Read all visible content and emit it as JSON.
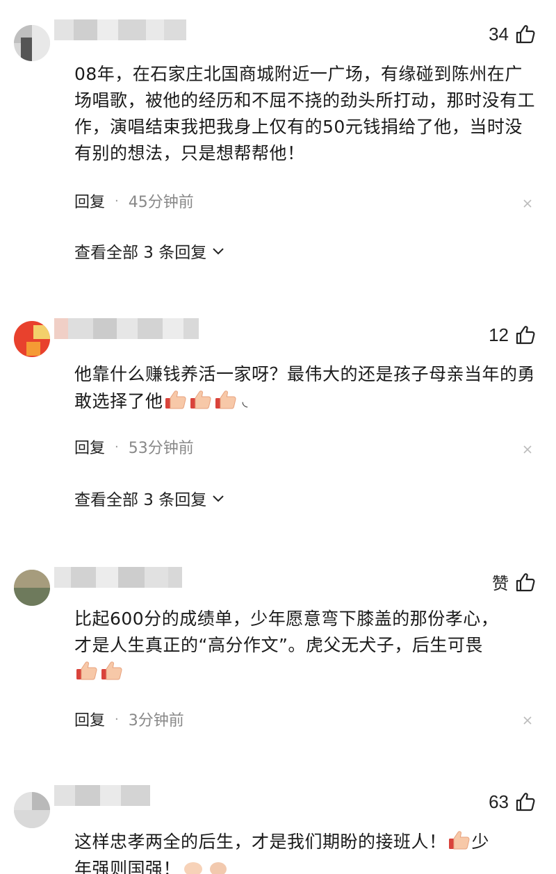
{
  "comments": [
    {
      "likes": "34",
      "text": "08年，在石家庄北国商城附近一广场，有缘碰到陈州在广场唱歌，被他的经历和不屈不挠的劲头所打动，那时没有工作，演唱结束我把我身上仅有的50元钱捐给了他，当时没有别的想法，只是想帮帮他！",
      "reply_label": "回复",
      "time": "45分钟前",
      "view_replies": "查看全部 3 条回复"
    },
    {
      "likes": "12",
      "text": "他靠什么赚钱养活一家呀？最伟大的还是孩子母亲当年的勇敢选择了他",
      "reply_label": "回复",
      "time": "53分钟前",
      "view_replies": "查看全部 3 条回复"
    },
    {
      "likes": "赞",
      "text_line1": "比起600分的成绩单，少年愿意弯下膝盖的那份孝心，",
      "text_line2": "才是人生真正的“高分作文”。虎父无犬子，后生可畏",
      "reply_label": "回复",
      "time": "3分钟前"
    },
    {
      "likes": "63",
      "text_a": "这样忠孝两全的后生，才是我们期盼的接班人！",
      "text_b": "少",
      "text_c": "年强则国强！"
    }
  ],
  "colors": {
    "text": "#1a1a1a",
    "time": "#888888",
    "blur_gray": "#d9d9d9"
  },
  "icons": [
    "thumb-up-icon",
    "close-icon",
    "chevron-down-icon",
    "thumbs-up-emoji"
  ]
}
